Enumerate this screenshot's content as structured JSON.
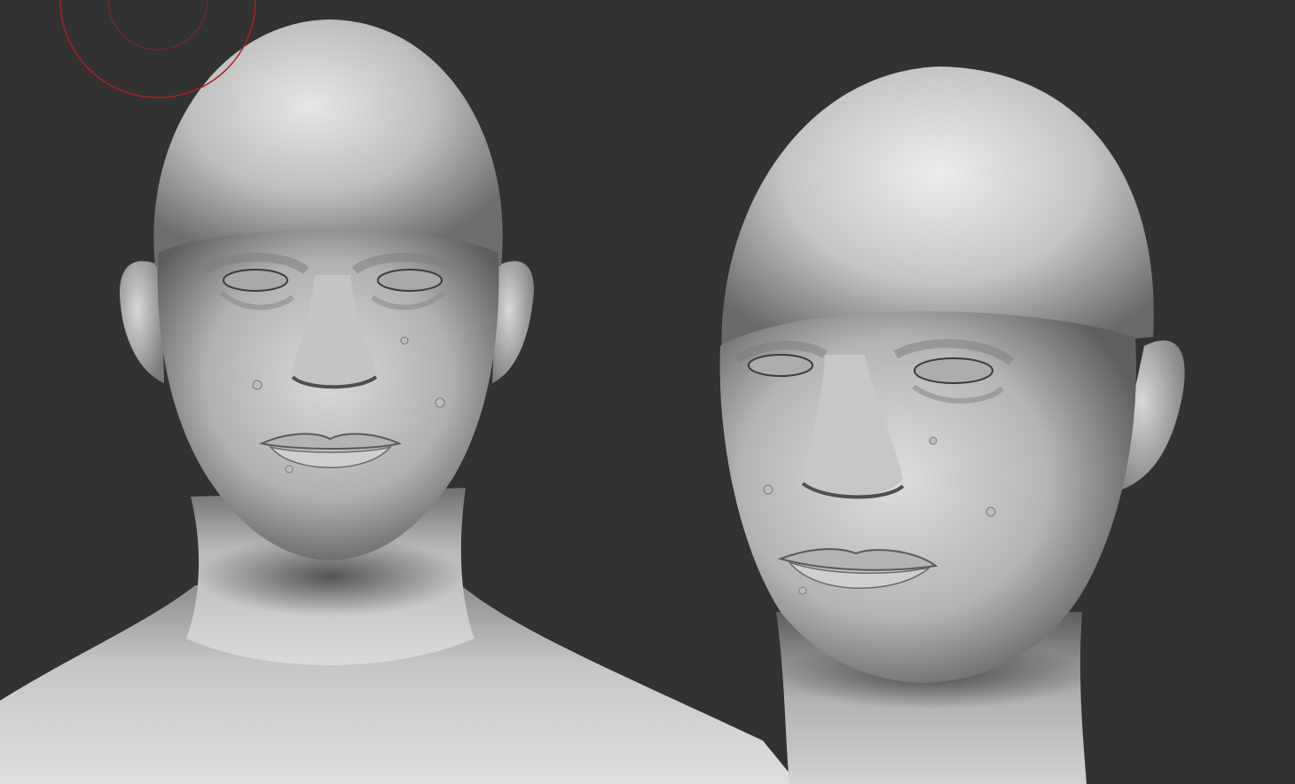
{
  "app": {
    "canvas_background": "#323232",
    "material_color": "#c9c9c9",
    "brush_cursor_color": "#b01e22"
  },
  "viewport": {
    "models": [
      {
        "name": "head-front-view"
      },
      {
        "name": "head-three-quarter-view"
      }
    ],
    "brush_cursor": {
      "visible": true,
      "icon": "brush-cursor-circle-icon"
    }
  }
}
